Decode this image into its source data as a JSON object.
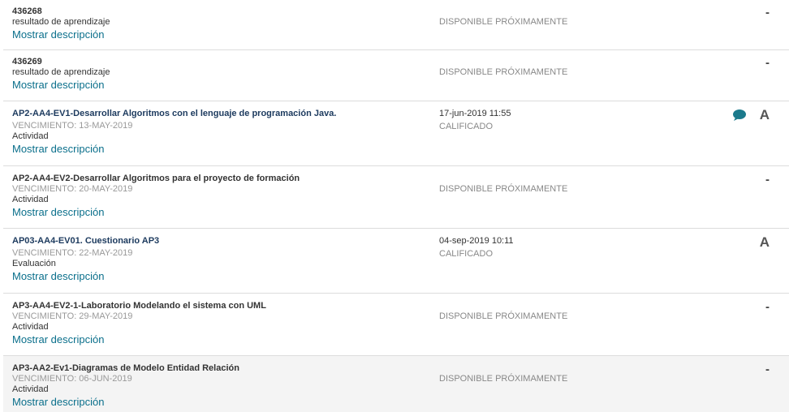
{
  "items": [
    {
      "title": "436268",
      "due": "",
      "type": "resultado de aprendizaje",
      "show": "Mostrar descripción",
      "date": "",
      "status": "DISPONIBLE PRÓXIMAMENTE",
      "grade": "-"
    },
    {
      "title": "436269",
      "due": "",
      "type": "resultado de aprendizaje",
      "show": "Mostrar descripción",
      "date": "",
      "status": "DISPONIBLE PRÓXIMAMENTE",
      "grade": "-"
    },
    {
      "title": "AP2-AA4-EV1-Desarrollar Algoritmos con el lenguaje de programación Java.",
      "due": "VENCIMIENTO: 13-MAY-2019",
      "type": "Actividad",
      "show": "Mostrar descripción",
      "date": "17-jun-2019 11:55",
      "status": "CALIFICADO",
      "grade": "A",
      "comment_icon": "speech-bubble-icon"
    },
    {
      "title": "AP2-AA4-EV2-Desarrollar Algoritmos para el proyecto de formación",
      "due": "VENCIMIENTO: 20-MAY-2019",
      "type": "Actividad",
      "show": "Mostrar descripción",
      "date": "",
      "status": "DISPONIBLE PRÓXIMAMENTE",
      "grade": "-"
    },
    {
      "title": "AP03-AA4-EV01. Cuestionario AP3",
      "due": "VENCIMIENTO: 22-MAY-2019",
      "type": "Evaluación",
      "show": "Mostrar descripción",
      "date": "04-sep-2019 10:11",
      "status": "CALIFICADO",
      "grade": "A"
    },
    {
      "title": "AP3-AA4-EV2-1-Laboratorio Modelando el sistema con UML",
      "due": "VENCIMIENTO: 29-MAY-2019",
      "type": "Actividad",
      "show": "Mostrar descripción",
      "date": "",
      "status": "DISPONIBLE PRÓXIMAMENTE",
      "grade": "-"
    },
    {
      "title": "AP3-AA2-Ev1-Diagramas de Modelo Entidad Relación",
      "due": "VENCIMIENTO: 06-JUN-2019",
      "type": "Actividad",
      "show": "Mostrar descripción",
      "date": "",
      "status": "DISPONIBLE PRÓXIMAMENTE",
      "grade": "-"
    }
  ],
  "colors": {
    "link": "#0a6f8b",
    "title_link": "#1c3a5e",
    "icon": "#1b7a8c",
    "hover_bg": "#f4f4f4"
  }
}
